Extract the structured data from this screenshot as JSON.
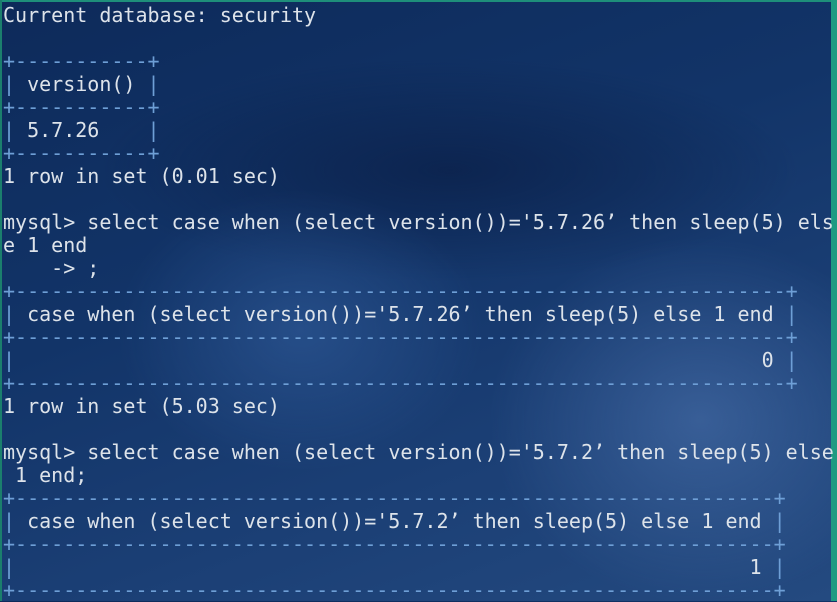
{
  "colors": {
    "text": "#dde3ea",
    "table_border": "#6e9fd6",
    "window_accent": "#1f9a82"
  },
  "lines": [
    {
      "kind": "text",
      "text": "Current database: security"
    },
    {
      "kind": "text",
      "text": ""
    },
    {
      "kind": "border",
      "text": "+-----------+"
    },
    {
      "kind": "row",
      "text": "version()",
      "width": 11
    },
    {
      "kind": "border",
      "text": "+-----------+"
    },
    {
      "kind": "row",
      "text": "5.7.26",
      "width": 11
    },
    {
      "kind": "border",
      "text": "+-----------+"
    },
    {
      "kind": "text",
      "text": "1 row in set (0.01 sec)"
    },
    {
      "kind": "text",
      "text": ""
    },
    {
      "kind": "text",
      "text": "mysql> select case when (select version())='5.7.26’ then sleep(5) els"
    },
    {
      "kind": "text",
      "text": "e 1 end"
    },
    {
      "kind": "text",
      "text": "    -> ;"
    },
    {
      "kind": "border",
      "text": "+----------------------------------------------------------------+"
    },
    {
      "kind": "row",
      "text": "case when (select version())='5.7.26’ then sleep(5) else 1 end",
      "width": 64
    },
    {
      "kind": "border",
      "text": "+----------------------------------------------------------------+"
    },
    {
      "kind": "row-num",
      "text": "0",
      "width": 64
    },
    {
      "kind": "border",
      "text": "+----------------------------------------------------------------+"
    },
    {
      "kind": "text",
      "text": "1 row in set (5.03 sec)"
    },
    {
      "kind": "text",
      "text": ""
    },
    {
      "kind": "text",
      "text": "mysql> select case when (select version())='5.7.2’ then sleep(5) else"
    },
    {
      "kind": "text",
      "text": " 1 end;"
    },
    {
      "kind": "border",
      "text": "+---------------------------------------------------------------+"
    },
    {
      "kind": "row",
      "text": "case when (select version())='5.7.2’ then sleep(5) else 1 end",
      "width": 63
    },
    {
      "kind": "border",
      "text": "+---------------------------------------------------------------+"
    },
    {
      "kind": "row-num",
      "text": "1",
      "width": 63
    },
    {
      "kind": "border",
      "text": "+---------------------------------------------------------------+"
    }
  ]
}
